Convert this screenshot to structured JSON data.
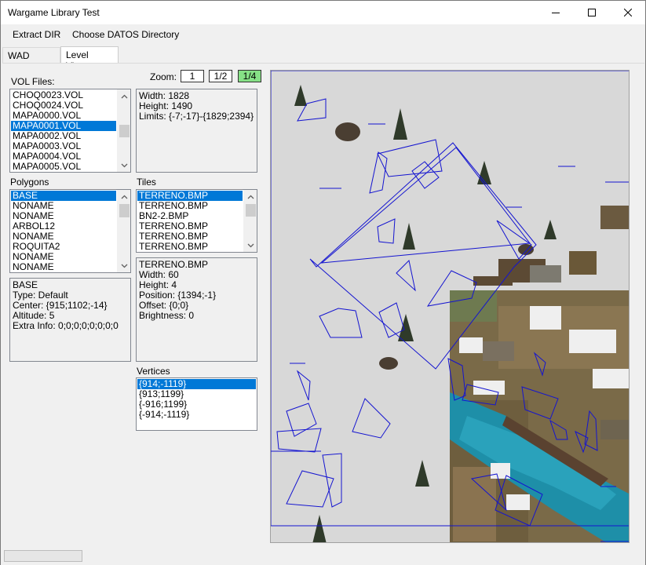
{
  "window": {
    "title": "Wargame Library Test"
  },
  "menu": {
    "extract_dir": "Extract DIR",
    "choose_datos": "Choose DATOS Directory"
  },
  "tabs": {
    "wad_viewer": "WAD Viewer",
    "level_viewer": "Level Viewer"
  },
  "vol_files": {
    "label": "VOL Files:",
    "items": [
      "CHOQ0023.VOL",
      "CHOQ0024.VOL",
      "MAPA0000.VOL",
      "MAPA0001.VOL",
      "MAPA0002.VOL",
      "MAPA0003.VOL",
      "MAPA0004.VOL",
      "MAPA0005.VOL"
    ],
    "selected": "MAPA0001.VOL"
  },
  "map_info": {
    "width": "Width: 1828",
    "height": "Height: 1490",
    "limits": "Limits: {-7;-17}-{1829;2394}"
  },
  "zoom": {
    "label": "Zoom:",
    "opt1": "1",
    "opt2": "1/2",
    "opt3": "1/4",
    "selected": "1/4",
    "active_color": "#86e086"
  },
  "polygons": {
    "label": "Polygons",
    "items": [
      "BASE",
      "NONAME",
      "NONAME",
      "ARBOL12",
      "NONAME",
      "ROQUITA2",
      "NONAME",
      "NONAME"
    ],
    "selected": "BASE"
  },
  "polygon_info": {
    "name": "BASE",
    "type": "Type: Default",
    "center": "Center: {915;1102;-14}",
    "altitude": "Altitude: 5",
    "extra": "Extra Info: 0;0;0;0;0;0;0;0"
  },
  "tiles": {
    "label": "Tiles",
    "items": [
      "TERRENO.BMP",
      "TERRENO.BMP",
      "BN2-2.BMP",
      "TERRENO.BMP",
      "TERRENO.BMP",
      "TERRENO.BMP"
    ],
    "selected": "TERRENO.BMP"
  },
  "tile_info": {
    "name": "TERRENO.BMP",
    "width": "Width: 60",
    "height": "Height: 4",
    "position": "Position: {1394;-1}",
    "offset": "Offset: {0;0}",
    "brightness": "Brightness: 0"
  },
  "vertices": {
    "label": "Vertices",
    "items": [
      "{914;-1119}",
      "{913;1199}",
      "{-916;1199}",
      "{-914;-1119}"
    ],
    "selected": "{914;-1119}"
  },
  "colors": {
    "selection": "#0078d7",
    "polygon_outline": "#1010d0",
    "snow": "#d7d7d7",
    "water": "#1e8fa8"
  },
  "icons": {
    "minimize": "minimize-icon",
    "maximize": "maximize-icon",
    "close": "close-icon",
    "scroll_up": "chevron-up-icon",
    "scroll_down": "chevron-down-icon"
  }
}
